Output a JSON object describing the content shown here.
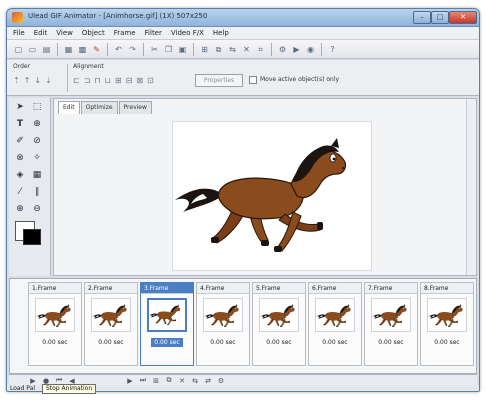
{
  "window": {
    "title": "Ulead GIF Animator - [Animhorse.gif] (1X) 507x250"
  },
  "menu": [
    "File",
    "Edit",
    "View",
    "Object",
    "Frame",
    "Filter",
    "Video F/X",
    "Help"
  ],
  "properties": {
    "order_label": "Order",
    "alignment_label": "Alignment",
    "properties_button": "Properties",
    "move_active_label": "Move active object(s) only"
  },
  "tabs": [
    "Edit",
    "Optimize",
    "Preview"
  ],
  "frames": [
    {
      "label": "1.Frame",
      "delay": "0.00 sec"
    },
    {
      "label": "2.Frame",
      "delay": "0.00 sec"
    },
    {
      "label": "3.Frame",
      "delay": "0.00 sec"
    },
    {
      "label": "4.Frame",
      "delay": "0.00 sec"
    },
    {
      "label": "5.Frame",
      "delay": "0.00 sec"
    },
    {
      "label": "6.Frame",
      "delay": "0.00 sec"
    },
    {
      "label": "7.Frame",
      "delay": "0.00 sec"
    },
    {
      "label": "8.Frame",
      "delay": "0.00 sec"
    }
  ],
  "selected_frame_index": 2,
  "status": {
    "text": "Load Pal"
  },
  "tooltip": {
    "text": "Stop Animation"
  },
  "colors": {
    "accent": "#4b7fc4",
    "horse_body": "#8a4b1d",
    "horse_mane": "#1c1410",
    "close_button": "#c4372a"
  }
}
